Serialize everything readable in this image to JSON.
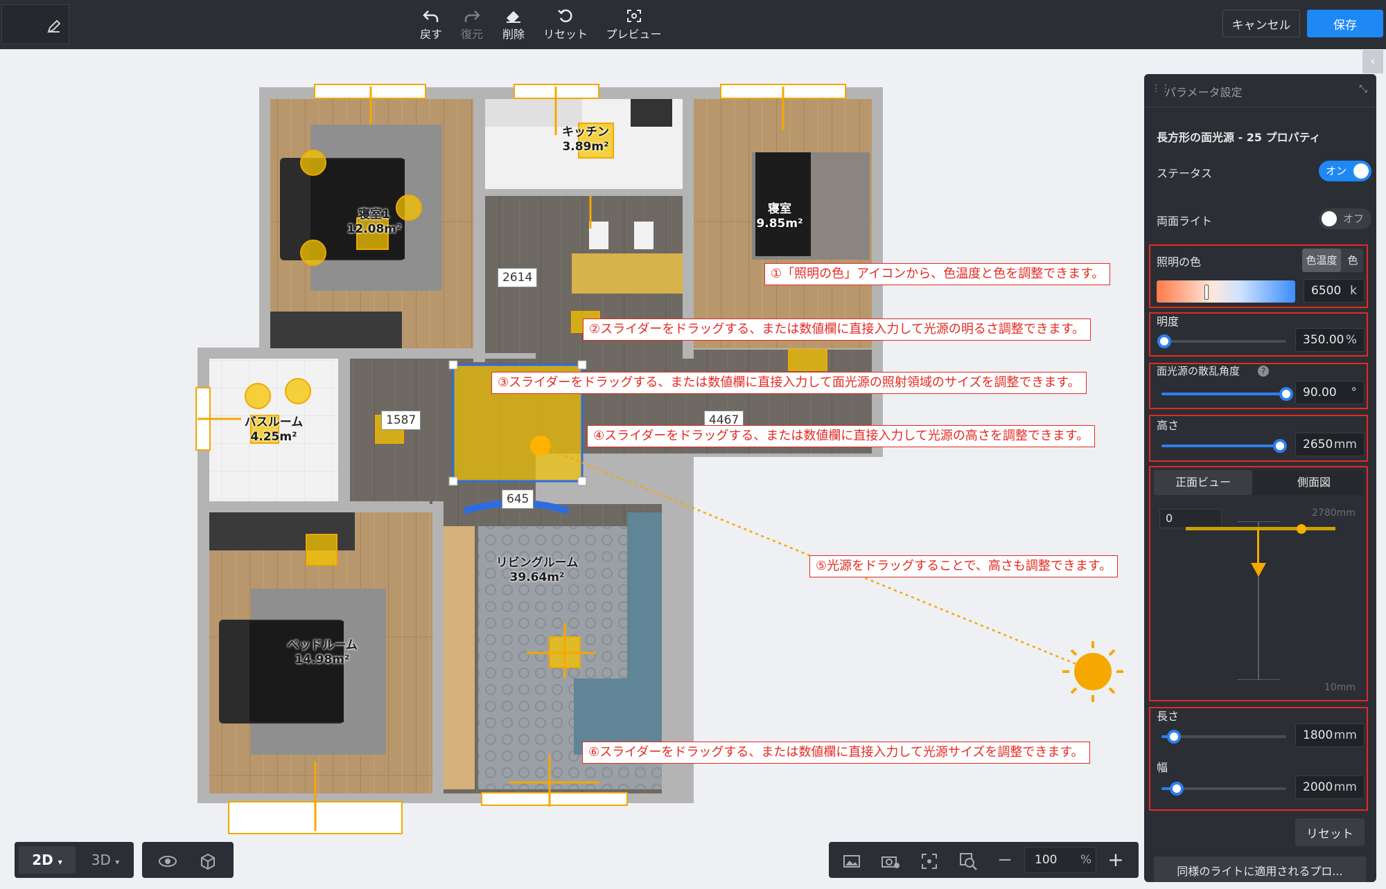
{
  "toolbar": {
    "undo_label": "戻す",
    "redo_label": "復元",
    "delete_label": "削除",
    "reset_label": "リセット",
    "preview_label": "プレビュー",
    "cancel_label": "キャンセル",
    "save_label": "保存"
  },
  "panel": {
    "header_title": "パラメータ設定",
    "subtitle": "長方形の面光源 - 25 プロパティ",
    "status_label": "ステータス",
    "status_value": "オン",
    "double_side_label": "両面ライト",
    "double_side_value": "オフ",
    "color_label": "照明の色",
    "color_tab_temp": "色温度",
    "color_tab_color": "色",
    "color_temp_value": "6500",
    "color_temp_unit": "k",
    "brightness_label": "明度",
    "brightness_value": "350.00",
    "brightness_unit": "%",
    "brightness_level": 0.02,
    "angle_label": "面光源の散乱角度",
    "angle_value": "90.00",
    "angle_unit": "°",
    "angle_level": 1.0,
    "height_label": "高さ",
    "height_value": "2650",
    "height_unit": "mm",
    "height_level": 0.95,
    "view_tab_front": "正面ビュー",
    "view_tab_side": "側面図",
    "view_input_value": "0",
    "view_max_label": "2780mm",
    "view_min_label": "10mm",
    "length_label": "長さ",
    "length_value": "1800",
    "length_unit": "mm",
    "length_level": 0.1,
    "width_label": "幅",
    "width_value": "2000",
    "width_unit": "mm",
    "width_level": 0.12,
    "reset_label": "リセット",
    "apply_label": "同様のライトに適用されるプロ..."
  },
  "annotations": {
    "a1": "①「照明の色」アイコンから、色温度と色を調整できます。",
    "a2": "②スライダーをドラッグする、または数値欄に直接入力して光源の明るさ調整できます。",
    "a3": "③スライダーをドラッグする、または数値欄に直接入力して面光源の照射領域のサイズを調整できます。",
    "a4": "④スライダーをドラッグする、または数値欄に直接入力して光源の高さを調整できます。",
    "a5": "⑤光源をドラッグすることで、高さも調整できます。",
    "a6": "⑥スライダーをドラッグする、または数値欄に直接入力して光源サイズを調整できます。"
  },
  "rooms": {
    "bedroom1_name": "寝室1",
    "bedroom1_area": "12.08m²",
    "kitchen_name": "キッチン",
    "kitchen_area": "3.89m²",
    "bedroom_name": "寝室",
    "bedroom_area": "9.85m²",
    "bath_name": "バスルーム",
    "bath_area": "4.25m²",
    "living_name": "リビングルーム",
    "living_area": "39.64m²",
    "bed_name": "ベッドルーム",
    "bed_area": "14.98m²"
  },
  "dimensions": {
    "d1": "2614",
    "d2": "1587",
    "d3": "4467",
    "d4": "645"
  },
  "bottom": {
    "mode_2d": "2D",
    "mode_3d": "3D",
    "zoom_value": "100",
    "zoom_unit": "%"
  },
  "colors": {
    "accent": "#1e88f5",
    "annotation_red": "#e32a22",
    "light_yellow": "#f5a800",
    "panel_bg": "#2b2e34"
  }
}
